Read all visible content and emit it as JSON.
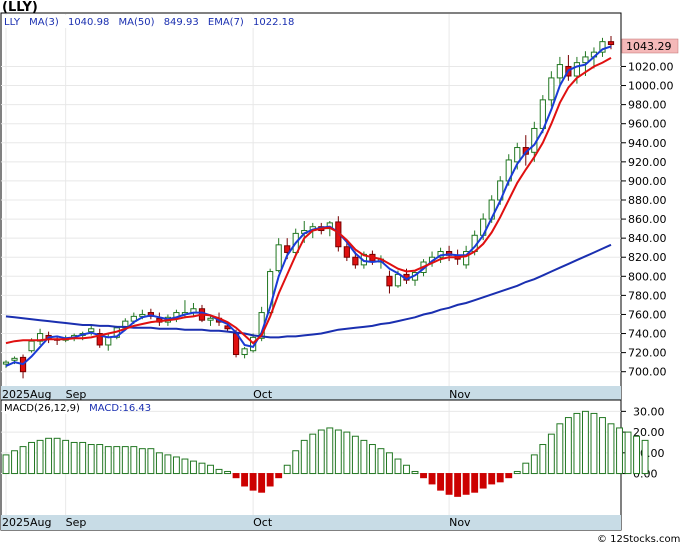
{
  "ticker_title": "(LLY)",
  "legend": {
    "ticker": "LLY",
    "ma3_label": "MA(3)",
    "ma3_value": "1040.98",
    "ma50_label": "MA(50)",
    "ma50_value": "849.93",
    "ema7_label": "EMA(7)",
    "ema7_value": "1022.18"
  },
  "macd_legend": {
    "label": "MACD(26,12,9)",
    "value_label": "MACD:16.43"
  },
  "last_price_label": "1043.29",
  "watermark": "© 12Stocks.com",
  "colors": {
    "ma3": "#1a3bd6",
    "ma50": "#1a2fb0",
    "ema7": "#e01010",
    "up_fill": "#ffffff",
    "up_stroke": "#227722",
    "down_fill": "#e01010",
    "down_stroke": "#770000",
    "macd_bar": "#227722",
    "macd_neg": "#cc0000",
    "axis_band": "#c8dce6",
    "price_tag": "#f4b8b8"
  },
  "chart_data": {
    "type": "candlestick",
    "price_axis": {
      "ylim": [
        685,
        1075
      ],
      "ticks": [
        700,
        720,
        740,
        760,
        780,
        800,
        820,
        840,
        860,
        880,
        900,
        920,
        940,
        960,
        980,
        1000,
        1020
      ],
      "tick_labels": [
        "700.00",
        "720.00",
        "740.00",
        "760.00",
        "780.00",
        "800.00",
        "820.00",
        "840.00",
        "860.00",
        "880.00",
        "900.00",
        "920.00",
        "940.00",
        "960.00",
        "980.00",
        "1000.00",
        "1020.00"
      ]
    },
    "macd_axis": {
      "ylim": [
        -20,
        35
      ],
      "ticks": [
        0,
        10,
        20,
        30
      ],
      "tick_labels": [
        "0.00",
        "10.00",
        "20.00",
        "30.00"
      ]
    },
    "x_labels": [
      {
        "label": "2025Aug",
        "bar": 0
      },
      {
        "label": "Sep",
        "bar": 7
      },
      {
        "label": "Oct",
        "bar": 29
      },
      {
        "label": "Nov",
        "bar": 52
      }
    ],
    "candles": [
      [
        708,
        712,
        704,
        710
      ],
      [
        712,
        716,
        708,
        714
      ],
      [
        715,
        718,
        693,
        700
      ],
      [
        722,
        735,
        720,
        732
      ],
      [
        732,
        745,
        728,
        740
      ],
      [
        738,
        742,
        730,
        734
      ],
      [
        734,
        737,
        728,
        733
      ],
      [
        733,
        738,
        731,
        735
      ],
      [
        735,
        740,
        732,
        738
      ],
      [
        738,
        742,
        733,
        740
      ],
      [
        742,
        748,
        738,
        745
      ],
      [
        740,
        745,
        725,
        728
      ],
      [
        728,
        740,
        722,
        736
      ],
      [
        736,
        748,
        734,
        746
      ],
      [
        746,
        756,
        744,
        753
      ],
      [
        753,
        762,
        750,
        758
      ],
      [
        758,
        765,
        755,
        760
      ],
      [
        762,
        766,
        755,
        758
      ],
      [
        756,
        762,
        748,
        752
      ],
      [
        752,
        760,
        748,
        757
      ],
      [
        757,
        765,
        752,
        762
      ],
      [
        760,
        775,
        756,
        762
      ],
      [
        762,
        772,
        758,
        766
      ],
      [
        766,
        770,
        752,
        754
      ],
      [
        754,
        760,
        748,
        756
      ],
      [
        756,
        762,
        748,
        752
      ],
      [
        748,
        752,
        742,
        745
      ],
      [
        740,
        744,
        715,
        718
      ],
      [
        718,
        726,
        714,
        724
      ],
      [
        722,
        740,
        720,
        736
      ],
      [
        735,
        768,
        732,
        762
      ],
      [
        762,
        808,
        760,
        805
      ],
      [
        806,
        840,
        804,
        833
      ],
      [
        832,
        840,
        818,
        825
      ],
      [
        825,
        850,
        822,
        845
      ],
      [
        845,
        858,
        835,
        848
      ],
      [
        848,
        856,
        840,
        852
      ],
      [
        852,
        856,
        844,
        848
      ],
      [
        850,
        858,
        842,
        856
      ],
      [
        857,
        863,
        826,
        831
      ],
      [
        831,
        836,
        816,
        820
      ],
      [
        820,
        826,
        808,
        812
      ],
      [
        812,
        826,
        808,
        823
      ],
      [
        823,
        827,
        812,
        816
      ],
      [
        815,
        822,
        808,
        818
      ],
      [
        800,
        806,
        782,
        790
      ],
      [
        790,
        806,
        788,
        802
      ],
      [
        802,
        808,
        792,
        796
      ],
      [
        796,
        806,
        790,
        804
      ],
      [
        804,
        818,
        800,
        815
      ],
      [
        815,
        826,
        810,
        820
      ],
      [
        820,
        830,
        814,
        826
      ],
      [
        826,
        832,
        816,
        822
      ],
      [
        822,
        828,
        812,
        818
      ],
      [
        812,
        832,
        808,
        826
      ],
      [
        826,
        848,
        822,
        843
      ],
      [
        843,
        866,
        838,
        860
      ],
      [
        860,
        885,
        856,
        880
      ],
      [
        880,
        905,
        875,
        900
      ],
      [
        900,
        928,
        895,
        922
      ],
      [
        920,
        940,
        912,
        935
      ],
      [
        935,
        948,
        916,
        928
      ],
      [
        930,
        962,
        920,
        955
      ],
      [
        955,
        990,
        950,
        985
      ],
      [
        985,
        1015,
        978,
        1008
      ],
      [
        1008,
        1030,
        1000,
        1022
      ],
      [
        1020,
        1032,
        1005,
        1010
      ],
      [
        1010,
        1030,
        1002,
        1024
      ],
      [
        1024,
        1036,
        1010,
        1030
      ],
      [
        1030,
        1040,
        1018,
        1035
      ],
      [
        1035,
        1050,
        1030,
        1046
      ],
      [
        1046,
        1052,
        1038,
        1043
      ]
    ],
    "series": [
      {
        "name": "MA(3)",
        "values": [
          706,
          710,
          708,
          716,
          726,
          736,
          737,
          735,
          736,
          739,
          741,
          738,
          736,
          737,
          744,
          752,
          757,
          759,
          757,
          755,
          757,
          760,
          762,
          762,
          759,
          754,
          750,
          741,
          728,
          726,
          741,
          768,
          800,
          822,
          835,
          845,
          849,
          851,
          852,
          846,
          836,
          824,
          816,
          815,
          816,
          808,
          803,
          797,
          801,
          808,
          816,
          822,
          823,
          822,
          822,
          831,
          843,
          861,
          879,
          900,
          918,
          930,
          938,
          953,
          975,
          1000,
          1016,
          1020,
          1022,
          1030,
          1038,
          1041
        ]
      },
      {
        "name": "MA(50)",
        "values": [
          758,
          757,
          756,
          755,
          754,
          753,
          752,
          751,
          750,
          749,
          749,
          748,
          748,
          747,
          747,
          746,
          746,
          746,
          745,
          745,
          745,
          744,
          744,
          744,
          743,
          743,
          742,
          741,
          740,
          738,
          737,
          736,
          736,
          737,
          737,
          738,
          739,
          740,
          742,
          744,
          745,
          746,
          747,
          748,
          750,
          751,
          753,
          755,
          757,
          760,
          762,
          765,
          767,
          770,
          772,
          775,
          778,
          781,
          784,
          787,
          790,
          794,
          797,
          801,
          805,
          809,
          813,
          817,
          821,
          825,
          829,
          833
        ]
      },
      {
        "name": "EMA(7)",
        "values": [
          730,
          732,
          733,
          733,
          733,
          734,
          734,
          734,
          735,
          735,
          736,
          738,
          740,
          742,
          745,
          748,
          750,
          752,
          753,
          754,
          755,
          757,
          758,
          760,
          759,
          756,
          752,
          746,
          738,
          730,
          738,
          758,
          782,
          802,
          822,
          840,
          848,
          850,
          851,
          846,
          838,
          828,
          822,
          820,
          818,
          813,
          808,
          805,
          806,
          810,
          814,
          818,
          820,
          820,
          821,
          826,
          834,
          846,
          862,
          880,
          898,
          912,
          925,
          940,
          960,
          982,
          998,
          1008,
          1014,
          1020,
          1024,
          1029
        ]
      }
    ],
    "macd_values": [
      9,
      11,
      13,
      15,
      16,
      17,
      17,
      16,
      15,
      15,
      14,
      14,
      13,
      13,
      13,
      13,
      12,
      12,
      10,
      9,
      8,
      7,
      6,
      5,
      4,
      2,
      1,
      -2,
      -6,
      -8,
      -9,
      -6,
      -2,
      4,
      11,
      16,
      19,
      21,
      22,
      21,
      20,
      18,
      16,
      14,
      12,
      10,
      7,
      4,
      1,
      -2,
      -5,
      -8,
      -10,
      -11,
      -10,
      -9,
      -7,
      -5,
      -4,
      -2,
      1,
      5,
      9,
      14,
      19,
      24,
      27,
      29,
      30,
      29,
      27,
      24,
      22,
      20,
      18,
      16
    ],
    "macd_colors_note": "",
    "xlabel": "",
    "ylabel": ""
  }
}
